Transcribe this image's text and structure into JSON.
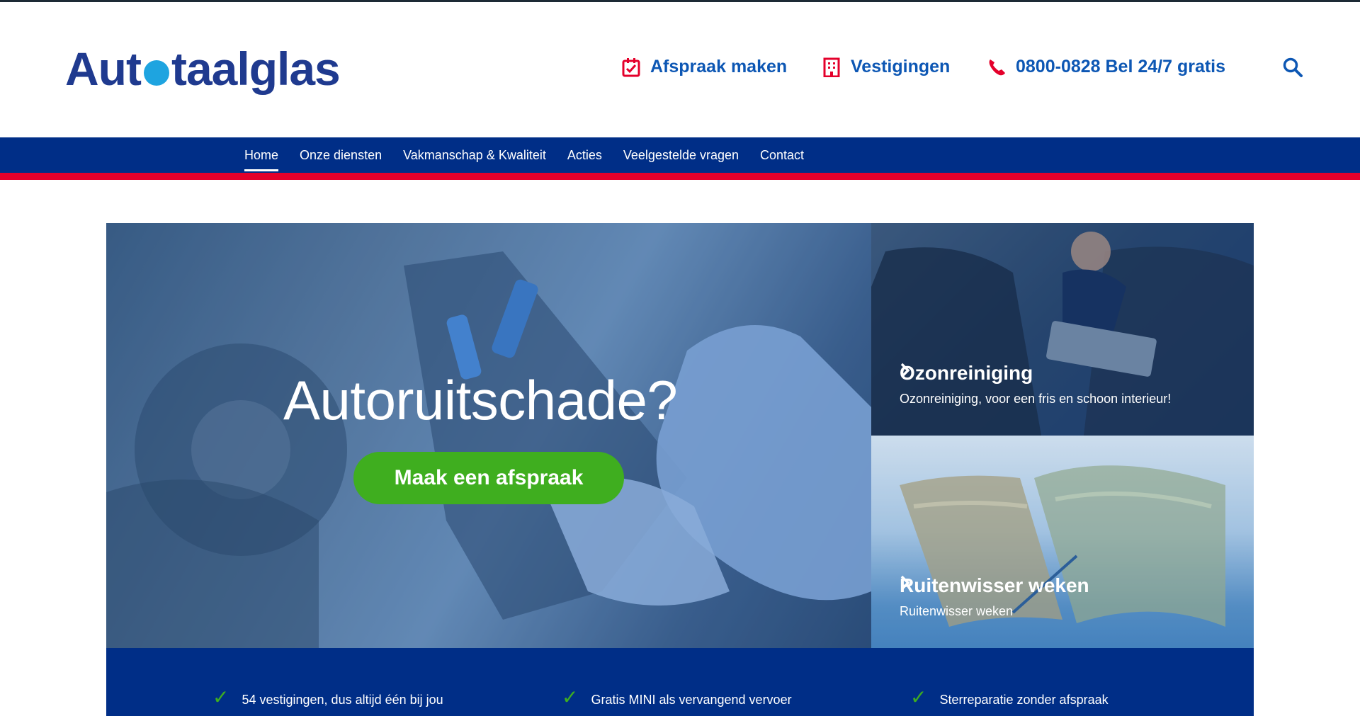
{
  "header": {
    "logo_left": "Aut",
    "logo_right": "taalglas",
    "links": [
      {
        "label": "Afspraak maken",
        "icon": "calendar-check-icon"
      },
      {
        "label": "Vestigingen",
        "icon": "building-icon"
      },
      {
        "label": "0800-0828 Bel 24/7 gratis",
        "icon": "phone-icon"
      }
    ],
    "search_icon": "search-icon"
  },
  "nav": {
    "items": [
      "Home",
      "Onze diensten",
      "Vakmanschap & Kwaliteit",
      "Acties",
      "Veelgestelde vragen",
      "Contact"
    ],
    "active": "Home"
  },
  "hero": {
    "title": "Autoruitschade?",
    "cta": "Maak een afspraak"
  },
  "promos": [
    {
      "title": "Ozonreiniging",
      "subtitle": "Ozonreiniging, voor een fris en schoon interieur!"
    },
    {
      "title": "Ruitenwisser weken",
      "subtitle": "Ruitenwisser weken"
    }
  ],
  "usps": [
    {
      "text": "54 vestigingen, dus altijd één bij jou"
    },
    {
      "text": "Gratis MINI als vervangend vervoer"
    },
    {
      "text": "Sterreparatie zonder afspraak"
    }
  ],
  "colors": {
    "brand_blue": "#002e87",
    "link_blue": "#0d57b4",
    "accent_red": "#e4002b",
    "cta_green": "#3fae1f",
    "logo_dot": "#1ea4e0"
  }
}
